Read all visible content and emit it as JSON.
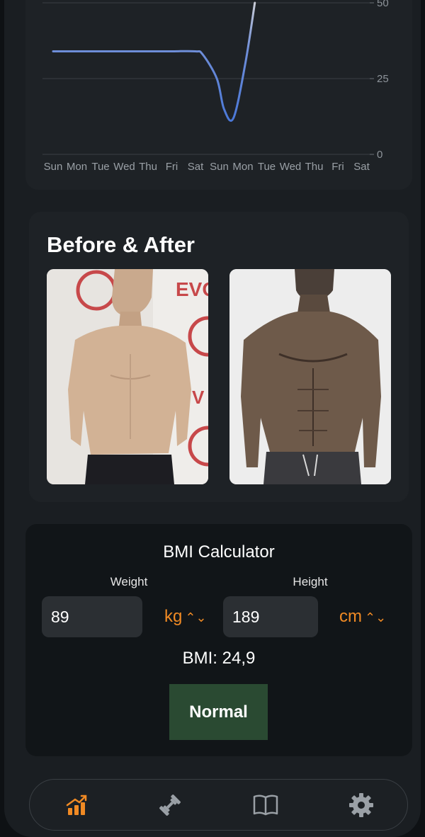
{
  "chart_data": {
    "type": "line",
    "categories": [
      "Sun",
      "Mon",
      "Tue",
      "Wed",
      "Thu",
      "Fri",
      "Sat",
      "Sun",
      "Mon",
      "Tue",
      "Wed",
      "Thu",
      "Fri",
      "Sat"
    ],
    "x_tick_labels": [
      "Sun",
      "Mon",
      "Tue",
      "Wed",
      "Thu",
      "Fri",
      "Sat",
      "Sun",
      "Mon",
      "Tue",
      "Wed",
      "Thu",
      "Fri",
      "Sat"
    ],
    "y_ticks": [
      0,
      25,
      50
    ],
    "y_tick_labels": [
      "0",
      "25",
      "50"
    ],
    "ylim": [
      0,
      50
    ],
    "grid": true,
    "series": [
      {
        "x": [
          0,
          1,
          2,
          3,
          3.5,
          4,
          4.5,
          5,
          6,
          6.3,
          6.9,
          7.2,
          7.6,
          8.1,
          8.5
        ],
        "values": [
          34,
          34,
          34,
          34,
          34,
          34,
          34,
          34,
          34,
          33,
          25,
          15,
          12,
          30,
          50
        ]
      }
    ],
    "color_start": "#4a78d8",
    "color_end": "#c9ccd6"
  },
  "before_after": {
    "title": "Before & After",
    "wall_text": "EVO"
  },
  "bmi": {
    "title": "BMI Calculator",
    "weight_label": "Weight",
    "height_label": "Height",
    "weight_value": "89",
    "height_value": "189",
    "weight_unit": "kg",
    "height_unit": "cm",
    "chevron": "⌃⌄",
    "result": "BMI: 24,9",
    "status": "Normal",
    "status_color": "#2a4a32",
    "accent": "#f08a24"
  },
  "nav": {
    "items": [
      {
        "icon": "chart-bar-icon",
        "active": true
      },
      {
        "icon": "dumbbell-icon",
        "active": false
      },
      {
        "icon": "book-icon",
        "active": false
      },
      {
        "icon": "gear-icon",
        "active": false
      }
    ],
    "active_color": "#f08a24",
    "inactive_color": "#9aa0a6"
  }
}
